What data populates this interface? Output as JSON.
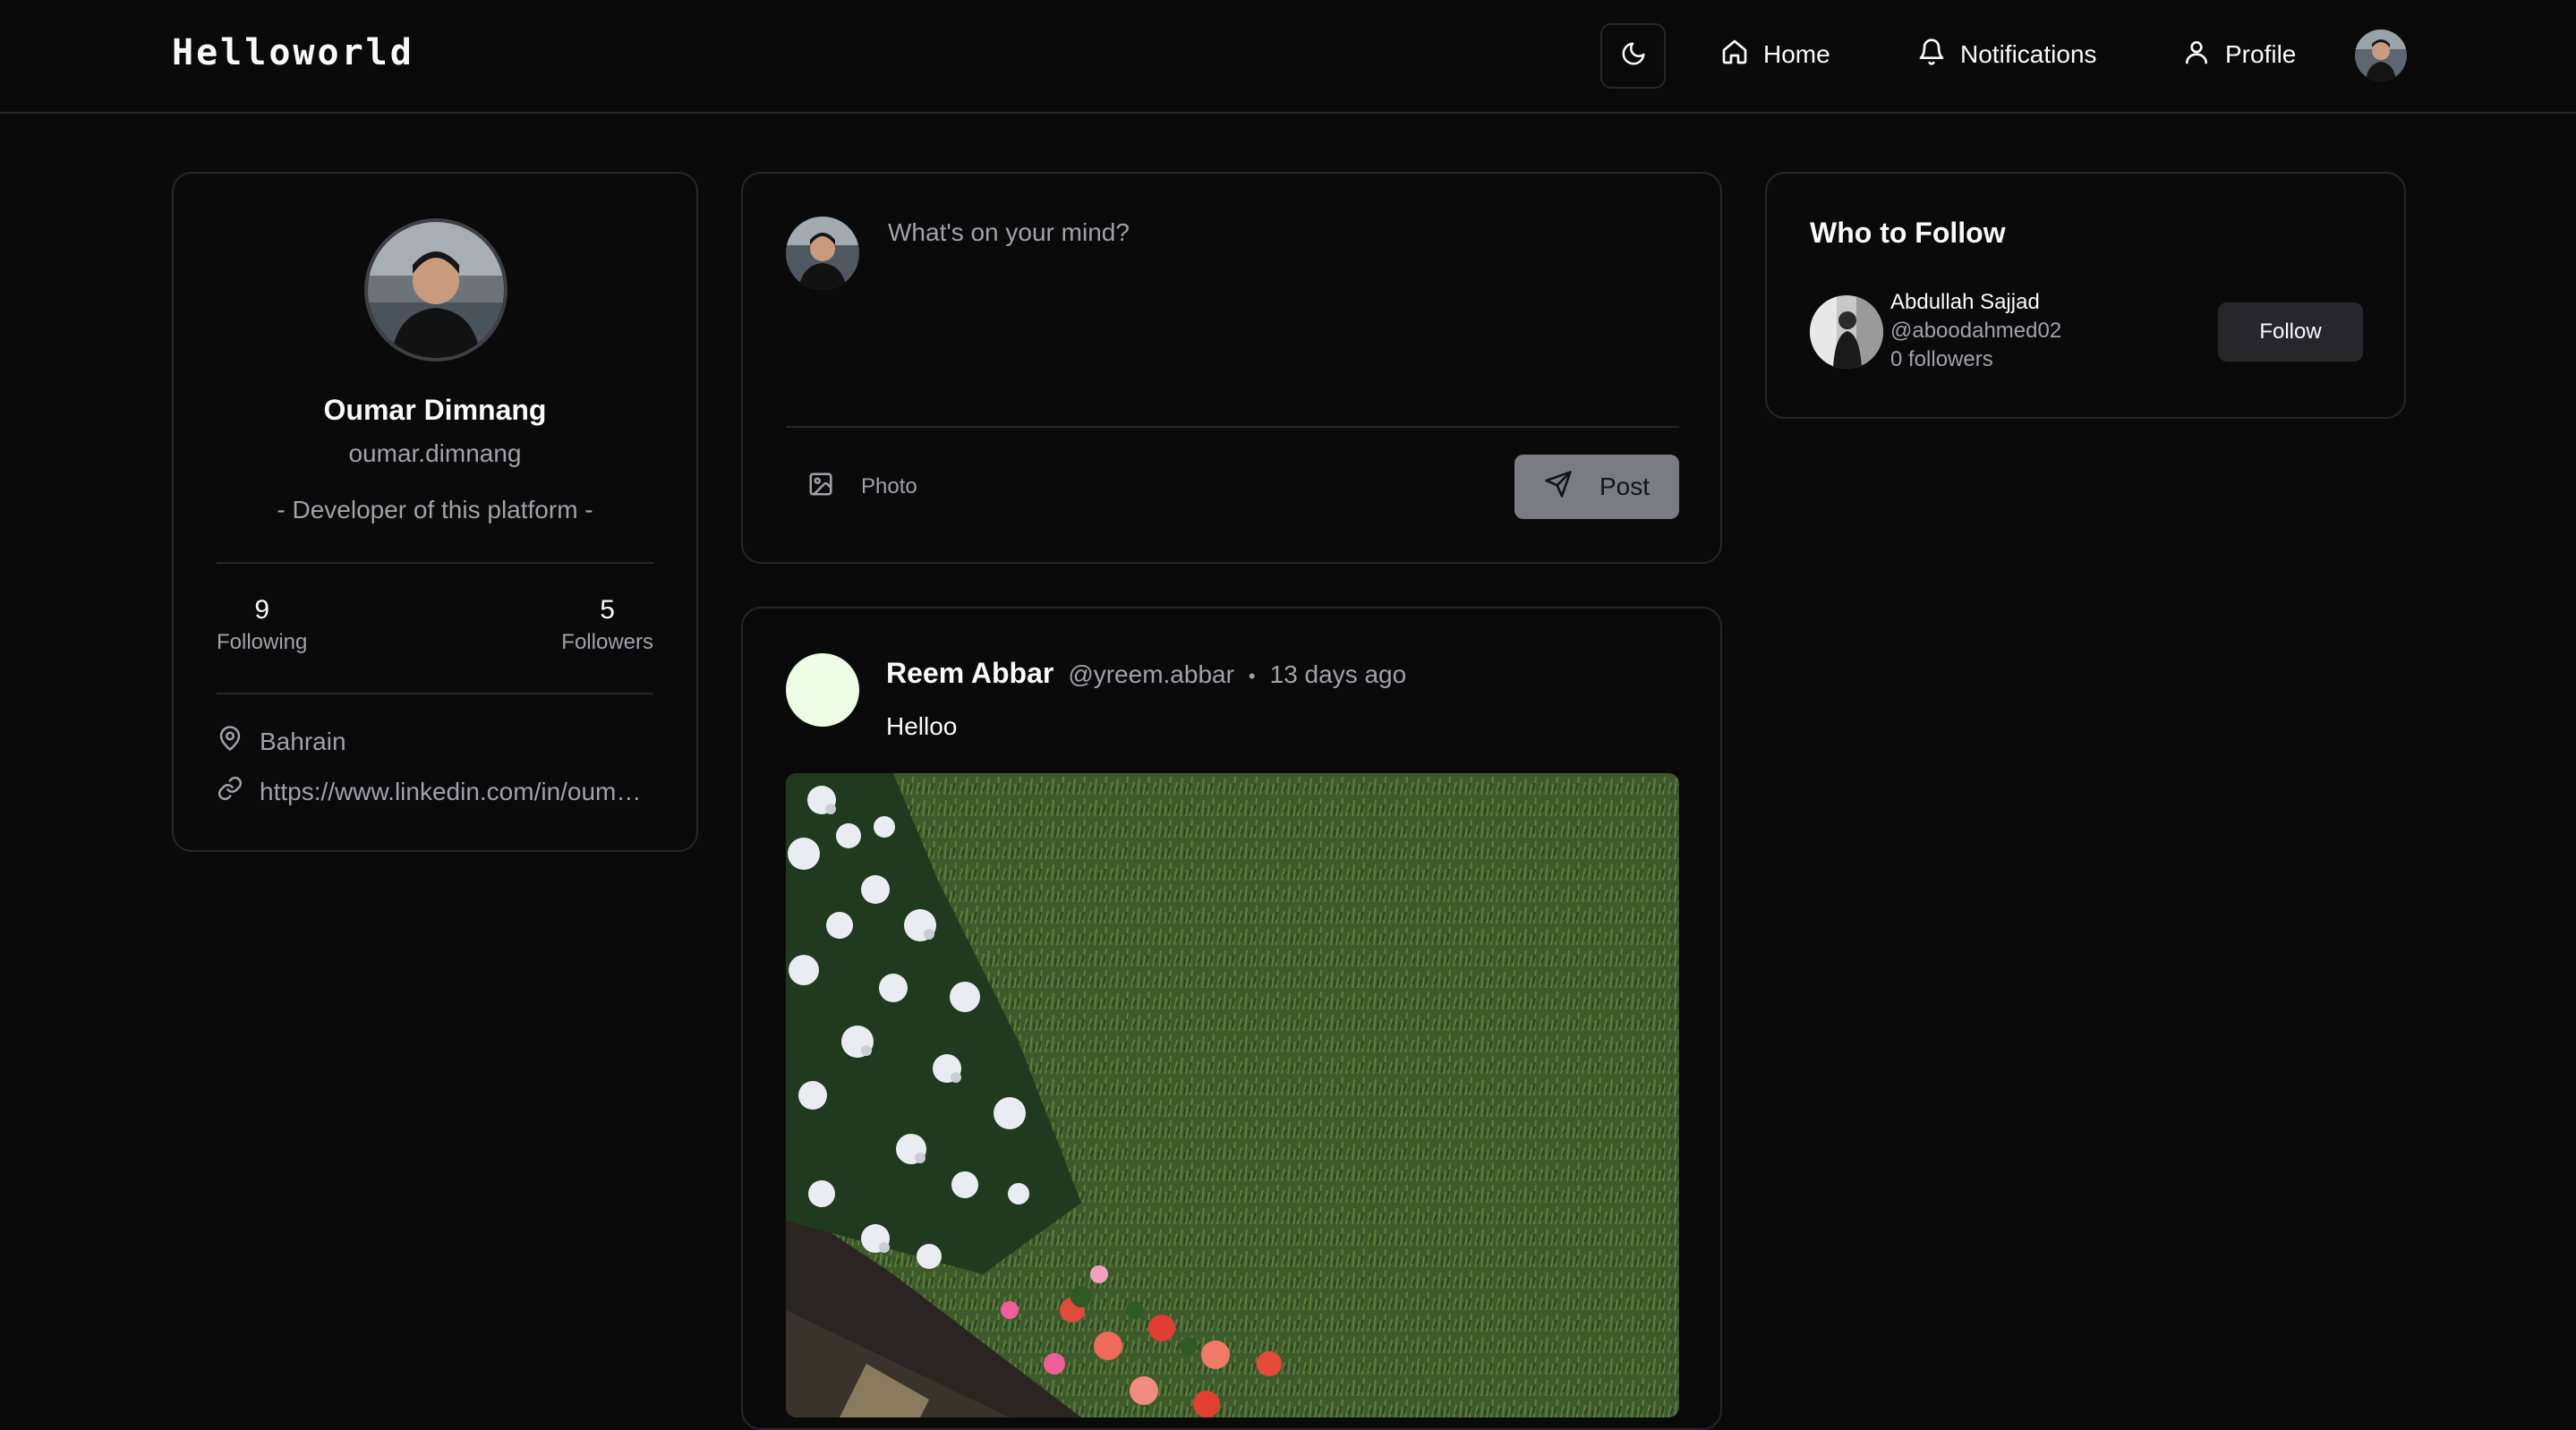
{
  "app": {
    "logo_text": "Helloworld"
  },
  "nav": {
    "home_label": "Home",
    "notifications_label": "Notifications",
    "profile_label": "Profile"
  },
  "profile": {
    "name": "Oumar Dimnang",
    "handle": "oumar.dimnang",
    "bio": "- Developer of this platform -",
    "following_count": "9",
    "following_label": "Following",
    "followers_count": "5",
    "followers_label": "Followers",
    "location": "Bahrain",
    "website": "https://www.linkedin.com/in/oum…"
  },
  "composer": {
    "placeholder": "What's on your mind?",
    "photo_label": "Photo",
    "post_label": "Post"
  },
  "feed": {
    "posts": [
      {
        "author": "Reem Abbar",
        "handle": "@yreem.abbar",
        "separator": "•",
        "time": "13 days ago",
        "text": "Helloo"
      }
    ]
  },
  "who_to_follow": {
    "title": "Who to Follow",
    "suggestions": [
      {
        "name": "Abdullah Sajjad",
        "handle": "@aboodahmed02",
        "followers": "0 followers",
        "button_label": "Follow"
      }
    ]
  },
  "colors": {
    "background": "#0a0a0a",
    "border": "#27272a",
    "text_primary": "#fafafa",
    "text_muted": "#a1a1aa",
    "post_avatar": "#ecfce5"
  },
  "icons": {
    "theme_toggle": "moon-icon",
    "home": "home-icon",
    "notifications": "bell-icon",
    "profile": "user-icon",
    "location": "map-pin-icon",
    "website": "link-icon",
    "photo": "image-icon",
    "post": "send-icon"
  }
}
